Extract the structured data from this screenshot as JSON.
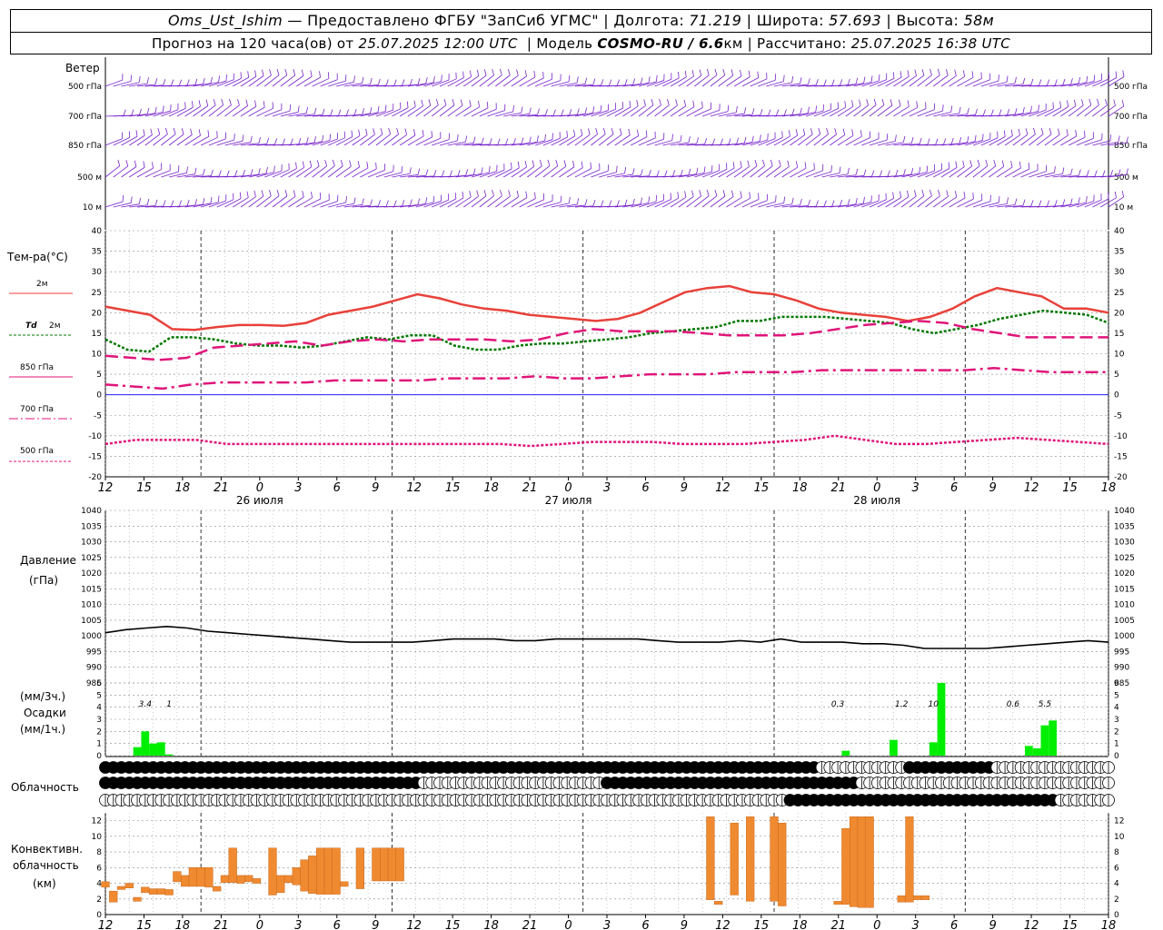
{
  "header": {
    "station": "Oms_Ust_Ishim",
    "provided": "— Предоставлено ФГБУ \"ЗапСиб УГМС\"",
    "lon_label": "Долгота:",
    "lon": "71.219",
    "lat_label": "Широта:",
    "lat": "57.693",
    "alt_label": "Высота:",
    "alt": "58м",
    "forecast_prefix": "Прогноз на 120 часа(ов) от",
    "forecast_time": "25.07.2025 12:00 UTC",
    "model_label": "Модель",
    "model": "COSMO-RU / 6.6",
    "model_unit": "км",
    "calc_label": "Рассчитано:",
    "calc_time": "25.07.2025 16:38 UTC"
  },
  "labels": {
    "wind": "Ветер",
    "wind_levels": [
      "500 гПа",
      "700 гПа",
      "850 гПа",
      "500 м",
      "10 м"
    ],
    "temp": "Тем-ра(°C)",
    "t2m": "2м",
    "td": "Td",
    "td2m": "2м",
    "t850": "850 гПа",
    "t700": "700 гПа",
    "t500": "500 гПа",
    "pressure": "Давление",
    "pressure_unit": "(гПа)",
    "precip_unit3": "(мм/3ч.)",
    "precip": "Осадки",
    "precip_unit1": "(мм/1ч.)",
    "cloud": "Облачность",
    "conv1": "Конвективн.",
    "conv2": "облачность",
    "conv3": "(км)"
  },
  "colors": {
    "t2m": "#e8413a",
    "td": "#007700",
    "t850": "#e0157a",
    "t700": "#e0157a",
    "t500": "#e0157a",
    "wind": "#7722cc",
    "precip": "#00ee00",
    "conv": "#f08a30",
    "zero_line": "#0000ff"
  },
  "chart_data": [
    {
      "type": "line",
      "name": "temperature",
      "x_hours": [
        0,
        3,
        6,
        9,
        12,
        15,
        18,
        21,
        24,
        27,
        30,
        33,
        36,
        39,
        42,
        45,
        48,
        51,
        54,
        57,
        60,
        63,
        66,
        69,
        72,
        75,
        78,
        81,
        84,
        87,
        90,
        93,
        96,
        99,
        102,
        105,
        108,
        111,
        114,
        117,
        120,
        123,
        126
      ],
      "ylim": [
        -20,
        40
      ],
      "yticks": [
        -20,
        -15,
        -10,
        -5,
        0,
        5,
        10,
        15,
        20,
        25,
        30,
        35,
        40
      ],
      "series": [
        {
          "name": "2м",
          "values": [
            21.5,
            20.5,
            19.5,
            16,
            15.8,
            16.5,
            17,
            17,
            16.8,
            17.5,
            19.5,
            20.5,
            21.5,
            23,
            24.5,
            23.5,
            22,
            21,
            20.5,
            19.5,
            19,
            18.5,
            18,
            18.5,
            20,
            22.5,
            25,
            26,
            26.5,
            25,
            24.5,
            23,
            21,
            20,
            19.5,
            19,
            18,
            19,
            21,
            24,
            26,
            25,
            24,
            21,
            21,
            20
          ]
        },
        {
          "name": "Td 2м",
          "values": [
            13.5,
            11,
            10.5,
            14,
            14,
            13.5,
            12.5,
            12,
            12,
            11.5,
            12,
            13,
            14,
            13.5,
            14.5,
            14.5,
            12,
            11,
            11,
            12,
            12.5,
            12.5,
            13,
            13.5,
            14,
            15,
            15.5,
            16,
            16.5,
            18,
            18,
            19,
            19,
            19,
            18.5,
            18,
            17.5,
            16,
            15,
            16,
            17,
            18.5,
            19.5,
            20.5,
            20,
            19.5,
            17.5
          ]
        },
        {
          "name": "850 гПа",
          "values": [
            9.5,
            9,
            8.5,
            9,
            11.5,
            12,
            12.5,
            13,
            12,
            13,
            13.5,
            13,
            13.5,
            13.5,
            13.5,
            13,
            13.5,
            15,
            16,
            15.5,
            15.5,
            15.5,
            15,
            14.5,
            14.5,
            14.5,
            15,
            16,
            17,
            17.5,
            18,
            17.5,
            16,
            15,
            14,
            14,
            14,
            14
          ]
        },
        {
          "name": "700 гПа",
          "values": [
            2.5,
            2,
            1.5,
            2.5,
            3,
            3,
            3,
            3,
            3.5,
            3.5,
            3.5,
            3.5,
            4,
            4,
            4,
            4.5,
            4,
            4,
            4.5,
            5,
            5,
            5,
            5.5,
            5.5,
            5.5,
            6,
            6,
            6,
            6,
            6,
            6,
            6.5,
            6,
            5.5,
            5.5,
            5.5
          ]
        },
        {
          "name": "500 гПа",
          "values": [
            -12,
            -11,
            -11,
            -11,
            -12,
            -12,
            -12,
            -12,
            -12,
            -12,
            -12,
            -12,
            -12,
            -12,
            -12.5,
            -12,
            -11.5,
            -11.5,
            -11.5,
            -12,
            -12,
            -12,
            -11.5,
            -11,
            -10,
            -11,
            -12,
            -12,
            -11.5,
            -11,
            -10.5,
            -11,
            -11.5,
            -12
          ]
        }
      ]
    },
    {
      "type": "line",
      "name": "pressure",
      "ylim": [
        985,
        1040
      ],
      "yticks": [
        985,
        990,
        995,
        1000,
        1005,
        1010,
        1015,
        1020,
        1025,
        1030,
        1035,
        1040
      ],
      "series": [
        {
          "name": "Давление",
          "values": [
            1001,
            1002,
            1002.5,
            1003,
            1002.5,
            1001.5,
            1001,
            1000.5,
            1000,
            999.5,
            999,
            998.5,
            998,
            998,
            998,
            998,
            998.5,
            999,
            999,
            999,
            998.5,
            998.5,
            999,
            999,
            999,
            999,
            999,
            998.5,
            998,
            998,
            998,
            998.5,
            998,
            999,
            998,
            998,
            998,
            997.5,
            997.5,
            997,
            996,
            996,
            996,
            996,
            996.5,
            997,
            997.5,
            998,
            998.5,
            998
          ]
        }
      ]
    },
    {
      "type": "bar",
      "name": "precipitation",
      "ylim": [
        0,
        6
      ],
      "yticks": [
        0,
        1,
        2,
        3,
        4,
        5,
        6
      ],
      "bars": [
        {
          "hour": 4,
          "value": 0.7
        },
        {
          "hour": 5,
          "value": 2.0
        },
        {
          "hour": 6,
          "value": 1.0
        },
        {
          "hour": 7,
          "value": 1.1
        },
        {
          "hour": 8,
          "value": 0.1
        },
        {
          "hour": 93,
          "value": 0.4
        },
        {
          "hour": 99,
          "value": 1.3
        },
        {
          "hour": 104,
          "value": 1.1
        },
        {
          "hour": 105,
          "value": 6.0
        },
        {
          "hour": 116,
          "value": 0.8
        },
        {
          "hour": 117,
          "value": 0.6
        },
        {
          "hour": 118,
          "value": 2.5
        },
        {
          "hour": 119,
          "value": 2.9
        }
      ],
      "totals3h": [
        {
          "hour": 5,
          "label": "3.4"
        },
        {
          "hour": 8,
          "label": "1"
        },
        {
          "hour": 92,
          "label": "0.3"
        },
        {
          "hour": 100,
          "label": "1.2"
        },
        {
          "hour": 104,
          "label": "10"
        },
        {
          "hour": 114,
          "label": "0.6"
        },
        {
          "hour": 118,
          "label": "5.5"
        }
      ]
    },
    {
      "type": "bar",
      "name": "convective_clouds",
      "ylim": [
        0,
        13
      ],
      "yticks": [
        0,
        2,
        4,
        6,
        8,
        10,
        12
      ],
      "bars": [
        {
          "hour": 0,
          "base": 3.5,
          "top": 4.2
        },
        {
          "hour": 1,
          "base": 1.6,
          "top": 3.0
        },
        {
          "hour": 2,
          "base": 3.2,
          "top": 3.6
        },
        {
          "hour": 3,
          "base": 3.4,
          "top": 4.0
        },
        {
          "hour": 4,
          "base": 1.7,
          "top": 2.2
        },
        {
          "hour": 5,
          "base": 2.8,
          "top": 3.5
        },
        {
          "hour": 6,
          "base": 2.6,
          "top": 3.3
        },
        {
          "hour": 7,
          "base": 2.6,
          "top": 3.3
        },
        {
          "hour": 8,
          "base": 2.5,
          "top": 3.2
        },
        {
          "hour": 9,
          "base": 4.2,
          "top": 5.5
        },
        {
          "hour": 10,
          "base": 3.6,
          "top": 5.0
        },
        {
          "hour": 11,
          "base": 3.6,
          "top": 6.0
        },
        {
          "hour": 12,
          "base": 3.6,
          "top": 6.0
        },
        {
          "hour": 13,
          "base": 3.5,
          "top": 6.0
        },
        {
          "hour": 14,
          "base": 3.0,
          "top": 3.6
        },
        {
          "hour": 15,
          "base": 4.1,
          "top": 5.0
        },
        {
          "hour": 16,
          "base": 4.1,
          "top": 8.5
        },
        {
          "hour": 17,
          "base": 4.0,
          "top": 5.0
        },
        {
          "hour": 18,
          "base": 4.2,
          "top": 5.0
        },
        {
          "hour": 19,
          "base": 4.0,
          "top": 4.6
        },
        {
          "hour": 21,
          "base": 2.5,
          "top": 8.5
        },
        {
          "hour": 22,
          "base": 2.8,
          "top": 5.0
        },
        {
          "hour": 23,
          "base": 4.1,
          "top": 5.0
        },
        {
          "hour": 24,
          "base": 3.8,
          "top": 6.0
        },
        {
          "hour": 25,
          "base": 3.0,
          "top": 7.0
        },
        {
          "hour": 26,
          "base": 2.7,
          "top": 7.5
        },
        {
          "hour": 27,
          "base": 2.6,
          "top": 8.5
        },
        {
          "hour": 28,
          "base": 2.6,
          "top": 8.5
        },
        {
          "hour": 29,
          "base": 2.6,
          "top": 8.5
        },
        {
          "hour": 30,
          "base": 3.6,
          "top": 4.2
        },
        {
          "hour": 32,
          "base": 3.3,
          "top": 8.5
        },
        {
          "hour": 34,
          "base": 4.3,
          "top": 8.5
        },
        {
          "hour": 35,
          "base": 4.3,
          "top": 8.5
        },
        {
          "hour": 36,
          "base": 4.3,
          "top": 8.5
        },
        {
          "hour": 37,
          "base": 4.3,
          "top": 8.5
        },
        {
          "hour": 76,
          "base": 1.9,
          "top": 12.5
        },
        {
          "hour": 77,
          "base": 1.3,
          "top": 1.7
        },
        {
          "hour": 79,
          "base": 2.5,
          "top": 11.7
        },
        {
          "hour": 81,
          "base": 1.7,
          "top": 12.5
        },
        {
          "hour": 84,
          "base": 1.7,
          "top": 12.5
        },
        {
          "hour": 85,
          "base": 1.1,
          "top": 11.7
        },
        {
          "hour": 92,
          "base": 1.3,
          "top": 1.7
        },
        {
          "hour": 93,
          "base": 1.3,
          "top": 11.0
        },
        {
          "hour": 94,
          "base": 1.0,
          "top": 12.5
        },
        {
          "hour": 95,
          "base": 0.9,
          "top": 12.5
        },
        {
          "hour": 96,
          "base": 0.9,
          "top": 12.5
        },
        {
          "hour": 100,
          "base": 1.6,
          "top": 2.4
        },
        {
          "hour": 101,
          "base": 1.6,
          "top": 12.5
        },
        {
          "hour": 102,
          "base": 1.9,
          "top": 2.4
        },
        {
          "hour": 103,
          "base": 1.9,
          "top": 2.4
        }
      ]
    }
  ],
  "axes": {
    "hours": [
      "12",
      "15",
      "18",
      "21",
      "0",
      "3",
      "6",
      "9",
      "12",
      "15",
      "18",
      "21",
      "0",
      "3",
      "6",
      "9",
      "12",
      "15",
      "18",
      "21",
      "0",
      "3",
      "6",
      "9",
      "12",
      "15",
      "18"
    ],
    "days": [
      {
        "label": "26 июля",
        "hour": 12
      },
      {
        "label": "27 июля",
        "hour": 36
      },
      {
        "label": "28 июля",
        "hour": 60
      }
    ]
  }
}
